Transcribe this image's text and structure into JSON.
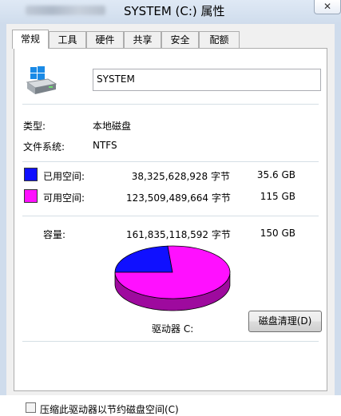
{
  "window": {
    "title": "SYSTEM (C:) 属性",
    "close_label": "✕"
  },
  "tabs": [
    "常规",
    "工具",
    "硬件",
    "共享",
    "安全",
    "配额"
  ],
  "general": {
    "icon": "drive-icon",
    "volume_name": "SYSTEM",
    "type_label": "类型:",
    "type_value": "本地磁盘",
    "fs_label": "文件系统:",
    "fs_value": "NTFS",
    "used": {
      "label": "已用空间:",
      "bytes": "38,325,628,928 字节",
      "size": "35.6 GB",
      "color": "#1010ff"
    },
    "free": {
      "label": "可用空间:",
      "bytes": "123,509,489,664 字节",
      "size": "115 GB",
      "color": "#ff10ff"
    },
    "capacity": {
      "label": "容量:",
      "bytes": "161,835,118,592 字节",
      "size": "150 GB"
    },
    "drive_label": "驱动器 C:",
    "cleanup_button": "磁盘清理(D)",
    "compress_label": "压缩此驱动器以节约磁盘空间(C)"
  },
  "chart_data": {
    "type": "pie",
    "categories": [
      "已用空间",
      "可用空间"
    ],
    "values": [
      38325628928,
      123509489664
    ],
    "colors": [
      "#1010ff",
      "#ff10ff"
    ]
  }
}
